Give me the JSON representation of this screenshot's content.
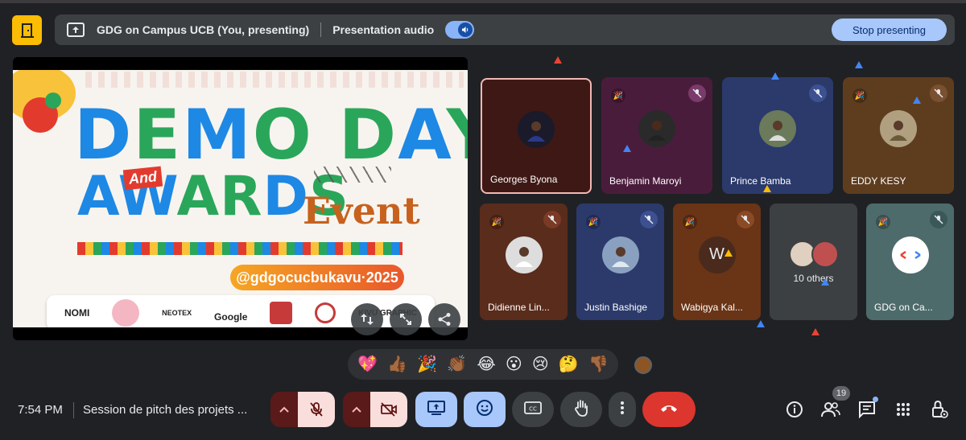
{
  "top_bar": {
    "presenting_label": "GDG on Campus UCB (You, presenting)",
    "audio_label": "Presentation audio",
    "audio_on": true,
    "stop_label": "Stop presenting"
  },
  "slide": {
    "title_line1": "DEMO DAY",
    "and_label": "And",
    "title_line2": "AWARDS",
    "event_label": "Event",
    "handle": "@gdgocucbukavu·2025",
    "sponsors": [
      "NOMI",
      "NEOTEX",
      "Google",
      "KIVU GRAPHIC"
    ]
  },
  "participants": [
    {
      "name": "Georges Byona",
      "muted": false
    },
    {
      "name": "Benjamin Maroyi",
      "muted": true
    },
    {
      "name": "Prince Bamba",
      "muted": true
    },
    {
      "name": "EDDY KESY",
      "muted": true
    },
    {
      "name": "Didienne Lin...",
      "muted": true
    },
    {
      "name": "Justin Bashige",
      "muted": true
    },
    {
      "name": "Wabigya Kal...",
      "muted": true,
      "initial": "W"
    },
    {
      "name": "GDG on Ca...",
      "muted": true
    }
  ],
  "others_label": "10 others",
  "reactions": [
    "💖",
    "👍🏾",
    "🎉",
    "👏🏾",
    "😂",
    "😮",
    "😢",
    "🤔",
    "👎🏾"
  ],
  "bottom_bar": {
    "time": "7:54 PM",
    "meeting_title": "Session de pitch des projets ...",
    "participant_count": "19"
  },
  "colors": {
    "background": "#202124",
    "accent_blue": "#a8c7fa",
    "end_call_red": "#dc362e",
    "exit_yellow": "#fbbc04"
  }
}
